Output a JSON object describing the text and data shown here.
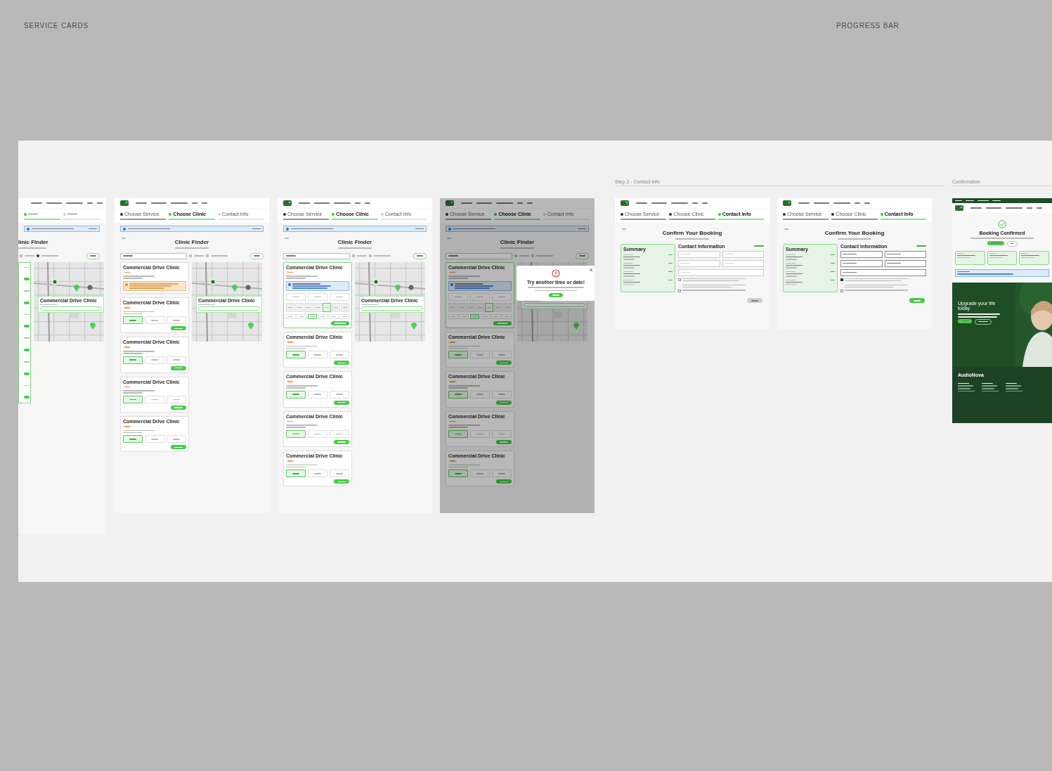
{
  "canvas_labels": [
    {
      "text": "SERVICE CARDS"
    },
    {
      "text": "PROGRESS BAR"
    }
  ],
  "section_labels": [
    {
      "text": "Step 3 - Contact info"
    },
    {
      "text": "Confirmation"
    }
  ],
  "frames": [
    {
      "kind": "finder-cut",
      "title": "linic Finder",
      "popup": "Commercial Drive Clinic",
      "steps": [
        {
          "completed": false,
          "selected": true
        },
        {
          "completed": false,
          "selected": false
        }
      ],
      "toggles": [
        {
          "checked": false
        },
        {
          "checked": true
        }
      ]
    },
    {
      "kind": "finder",
      "title": "Clinic Finder",
      "popup": "Commercial Drive Clinic",
      "dimmed": false,
      "steps": [
        {
          "label": "Choose Service",
          "completed": true,
          "selected": false
        },
        {
          "label": "Choose Clinic",
          "completed": false,
          "selected": true
        },
        {
          "label": "Contact Info",
          "completed": false,
          "selected": false
        }
      ],
      "toggles": [
        {
          "checked": false
        },
        {
          "checked": false
        }
      ],
      "cards": [
        {
          "kind": "alert",
          "title": "Commercial Drive Clinic"
        },
        {
          "kind": "slots",
          "title": "Commercial Drive Clinic",
          "slots": [
            {
              "selected": true
            },
            {
              "selected": false
            },
            {
              "selected": false
            }
          ]
        },
        {
          "kind": "slots",
          "title": "Commercial Drive Clinic",
          "slots": [
            {
              "selected": true
            },
            {
              "selected": false
            },
            {
              "selected": false
            }
          ]
        },
        {
          "kind": "slots",
          "title": "Commercial Drive Clinic",
          "slots": [
            {
              "selected": true
            },
            {
              "selected": false
            },
            {
              "selected": false
            }
          ]
        },
        {
          "kind": "slots",
          "title": "Commercial Drive Clinic",
          "slots": [
            {
              "selected": true
            },
            {
              "selected": false
            },
            {
              "selected": false
            }
          ]
        }
      ]
    },
    {
      "kind": "finder",
      "title": "Clinic Finder",
      "popup": "Commercial Drive Clinic",
      "dimmed": false,
      "steps": [
        {
          "label": "Choose Service",
          "completed": true,
          "selected": false
        },
        {
          "label": "Choose Clinic",
          "completed": false,
          "selected": true
        },
        {
          "label": "Contact Info",
          "completed": false,
          "selected": false
        }
      ],
      "toggles": [
        {
          "checked": false
        },
        {
          "checked": false
        }
      ],
      "cards": [
        {
          "kind": "expanded",
          "title": "Commercial Drive Clinic",
          "slots": [
            {
              "selected": false
            },
            {
              "selected": false
            },
            {
              "selected": false
            }
          ],
          "dates": [
            {
              "selected": false
            },
            {
              "selected": false
            },
            {
              "selected": false
            },
            {
              "selected": false
            },
            {
              "selected": true
            },
            {
              "selected": false
            },
            {
              "selected": false
            }
          ],
          "times": [
            {
              "selected": false
            },
            {
              "selected": false
            },
            {
              "selected": true
            },
            {
              "selected": false
            },
            {
              "selected": false
            },
            {
              "selected": false
            }
          ]
        },
        {
          "kind": "slots",
          "title": "Commercial Drive Clinic",
          "slots": [
            {
              "selected": true
            },
            {
              "selected": false
            },
            {
              "selected": false
            }
          ]
        },
        {
          "kind": "slots",
          "title": "Commercial Drive Clinic",
          "slots": [
            {
              "selected": true
            },
            {
              "selected": false
            },
            {
              "selected": false
            }
          ]
        },
        {
          "kind": "slots",
          "title": "Commercial Drive Clinic",
          "slots": [
            {
              "selected": true
            },
            {
              "selected": false
            },
            {
              "selected": false
            }
          ]
        },
        {
          "kind": "slots",
          "title": "Commercial Drive Clinic",
          "slots": [
            {
              "selected": true
            },
            {
              "selected": false
            },
            {
              "selected": false
            }
          ]
        }
      ]
    },
    {
      "kind": "finder",
      "title": "Clinic Finder",
      "dimmed": true,
      "modal": {
        "title": "Try another time or date!"
      },
      "steps": [
        {
          "label": "Choose Service",
          "completed": true,
          "selected": false
        },
        {
          "label": "Choose Clinic",
          "completed": false,
          "selected": true
        },
        {
          "label": "Contact Info",
          "completed": false,
          "selected": false
        }
      ],
      "toggles": [
        {
          "checked": false
        },
        {
          "checked": false
        }
      ],
      "cards": [
        {
          "kind": "expanded",
          "title": "Commercial Drive Clinic",
          "dates": [
            {
              "selected": false
            },
            {
              "selected": false
            },
            {
              "selected": false
            },
            {
              "selected": false
            },
            {
              "selected": true
            },
            {
              "selected": false
            },
            {
              "selected": false
            }
          ],
          "times": [
            {
              "selected": false
            },
            {
              "selected": false
            },
            {
              "selected": true
            },
            {
              "selected": false
            },
            {
              "selected": false
            },
            {
              "selected": false
            }
          ]
        },
        {
          "kind": "slots",
          "title": "Commercial Drive Clinic",
          "slots": [
            {
              "selected": true
            },
            {
              "selected": false
            },
            {
              "selected": false
            }
          ]
        },
        {
          "kind": "slots",
          "title": "Commercial Drive Clinic",
          "slots": [
            {
              "selected": true
            },
            {
              "selected": false
            },
            {
              "selected": false
            }
          ]
        },
        {
          "kind": "slots",
          "title": "Commercial Drive Clinic",
          "slots": [
            {
              "selected": true
            },
            {
              "selected": false
            },
            {
              "selected": false
            }
          ]
        },
        {
          "kind": "slots",
          "title": "Commercial Drive Clinic",
          "slots": [
            {
              "selected": true
            },
            {
              "selected": false
            },
            {
              "selected": false
            }
          ]
        }
      ]
    },
    {
      "kind": "confirm",
      "title": "Confirm Your Booking",
      "summary_title": "Summary",
      "contact_title": "Contact Information",
      "steps": [
        {
          "label": "Choose Service",
          "completed": true,
          "selected": false
        },
        {
          "label": "Choose Clinic",
          "completed": true,
          "selected": false
        },
        {
          "label": "Contact Info",
          "completed": false,
          "selected": true
        }
      ],
      "fields": [
        {
          "filled": false
        },
        {
          "filled": false
        },
        {
          "filled": false
        },
        {
          "filled": false
        },
        {
          "filled": false
        }
      ],
      "consents": [
        {
          "checked": false
        },
        {
          "checked": false
        }
      ],
      "submit": {
        "disabled": true
      }
    },
    {
      "kind": "confirm",
      "title": "Confirm Your Booking",
      "summary_title": "Summary",
      "contact_title": "Contact Information",
      "steps": [
        {
          "label": "Choose Service",
          "completed": true,
          "selected": false
        },
        {
          "label": "Choose Clinic",
          "completed": true,
          "selected": false
        },
        {
          "label": "Contact Info",
          "completed": false,
          "selected": true
        }
      ],
      "fields": [
        {
          "filled": true
        },
        {
          "filled": true
        },
        {
          "filled": true
        },
        {
          "filled": true
        },
        {
          "filled": true
        }
      ],
      "consents": [
        {
          "checked": true
        },
        {
          "checked": false
        }
      ],
      "submit": {
        "disabled": false
      }
    },
    {
      "kind": "confirmation",
      "title": "Booking Confirmed",
      "hero_title": "Upgrade your life today",
      "footer_logo": "AudioNova"
    }
  ]
}
